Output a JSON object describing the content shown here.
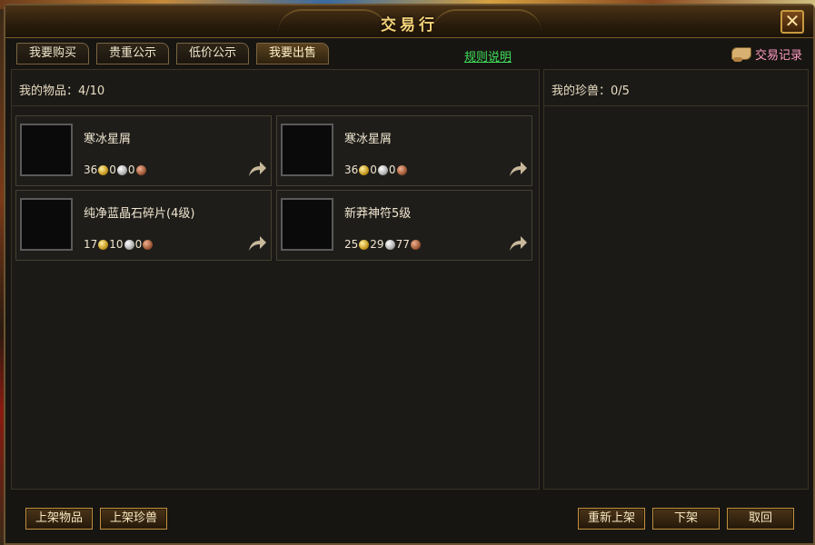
{
  "window": {
    "title": "交易行"
  },
  "tabs": [
    {
      "label": "我要购买"
    },
    {
      "label": "贵重公示"
    },
    {
      "label": "低价公示"
    },
    {
      "label": "我要出售"
    }
  ],
  "links": {
    "rules": "规则说明",
    "trade_record": "交易记录"
  },
  "left_panel": {
    "header": "我的物品：4/10"
  },
  "right_panel": {
    "header": "我的珍兽：0/5"
  },
  "items": [
    {
      "name": "寒冰星屑",
      "gold": "36",
      "silver": "0",
      "copper": "0",
      "icon": "ice-shard-icon"
    },
    {
      "name": "寒冰星屑",
      "gold": "36",
      "silver": "0",
      "copper": "0",
      "icon": "ice-shard-icon"
    },
    {
      "name": "纯净蓝晶石碎片(4级)",
      "gold": "17",
      "silver": "10",
      "copper": "0",
      "icon": "blue-crystal-icon"
    },
    {
      "name": "新莽神符5级",
      "gold": "25",
      "silver": "29",
      "copper": "77",
      "icon": "green-talisman-icon"
    }
  ],
  "buttons": {
    "list_item": "上架物品",
    "list_pet": "上架珍兽",
    "relist": "重新上架",
    "delist": "下架",
    "cancel": "取回"
  },
  "colors": {
    "rules_link": "#3fe05a",
    "trade_record": "#ff9ac0",
    "title": "#f3d27a"
  }
}
